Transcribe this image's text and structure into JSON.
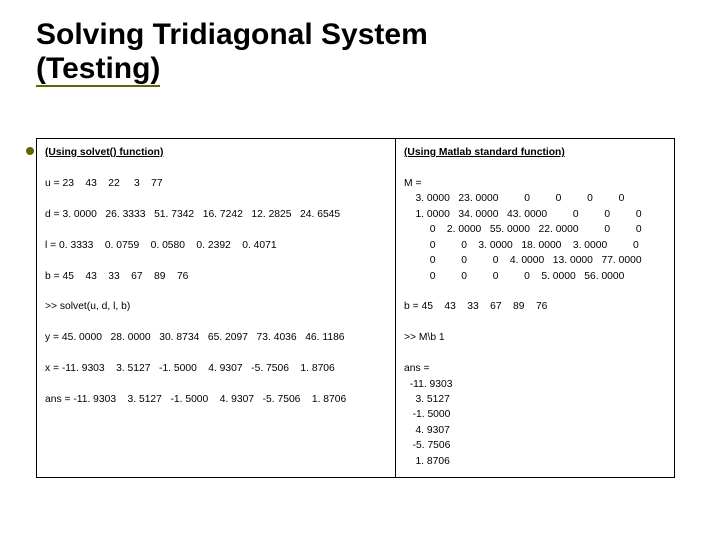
{
  "title": {
    "line1": "Solving Tridiagonal System",
    "line2": "(Testing)"
  },
  "left_panel": {
    "heading": "(Using solvet() function)",
    "body": "u = 23    43    22     3    77\n\nd = 3. 0000   26. 3333   51. 7342   16. 7242   12. 2825   24. 6545\n\nl = 0. 3333    0. 0759    0. 0580    0. 2392    0. 4071\n\nb = 45    43    33    67    89    76\n\n>> solvet(u, d, l, b)\n\ny = 45. 0000   28. 0000   30. 8734   65. 2097   73. 4036   46. 1186\n\nx = -11. 9303    3. 5127   -1. 5000    4. 9307   -5. 7506    1. 8706\n\nans = -11. 9303    3. 5127   -1. 5000    4. 9307   -5. 7506    1. 8706"
  },
  "right_panel": {
    "heading": "(Using Matlab standard function)",
    "body": "M =\n    3. 0000   23. 0000         0         0         0         0\n    1. 0000   34. 0000   43. 0000         0         0         0\n         0    2. 0000   55. 0000   22. 0000         0         0\n         0         0    3. 0000   18. 0000    3. 0000         0\n         0         0         0    4. 0000   13. 0000   77. 0000\n         0         0         0         0    5. 0000   56. 0000\n\nb = 45    43    33    67    89    76\n\n>> M\\b 1\n\nans =\n  -11. 9303\n    3. 5127\n   -1. 5000\n    4. 9307\n   -5. 7506\n    1. 8706"
  }
}
